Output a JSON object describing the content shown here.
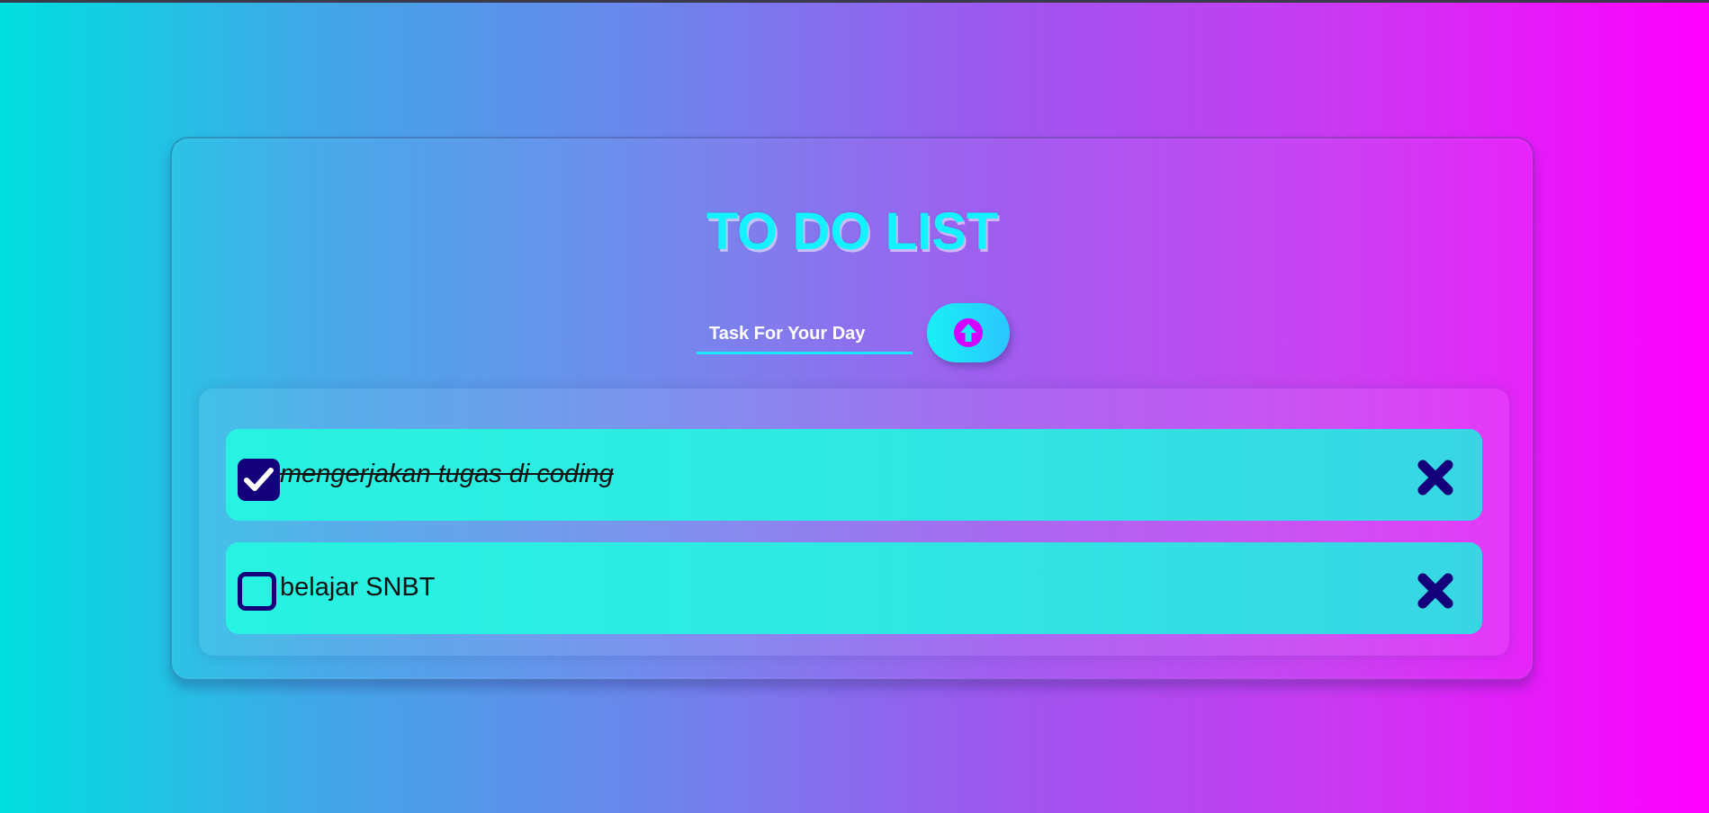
{
  "app": {
    "title": "TO DO LIST"
  },
  "input": {
    "placeholder": "Task For Your Day",
    "value": ""
  },
  "add_button": {
    "icon": "arrow-up-circle-icon"
  },
  "tasks": [
    {
      "text": "mengerjakan tugas di coding",
      "done": true
    },
    {
      "text": "belajar SNBT",
      "done": false
    }
  ],
  "icons": {
    "checked": "check-icon",
    "delete": "x-mark-icon"
  },
  "colors": {
    "background_start": "#00e0e0",
    "background_end": "#ff00ff",
    "title": "#15f2ff",
    "input_underline": "#19e8ff",
    "button": "#19f0f5",
    "button_icon": "#d100ff",
    "item_background": "#2eeae2",
    "checkbox": "#13007a",
    "delete_icon": "#13007a"
  }
}
